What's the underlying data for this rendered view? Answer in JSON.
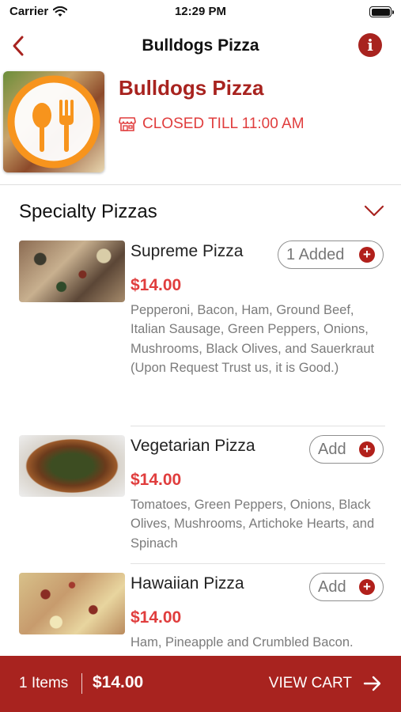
{
  "status_bar": {
    "carrier": "Carrier",
    "time": "12:29 PM"
  },
  "nav": {
    "title": "Bulldogs Pizza",
    "info_icon": "i"
  },
  "restaurant": {
    "name": "Bulldogs Pizza",
    "status": "CLOSED TILL 11:00 AM"
  },
  "section": {
    "title": "Specialty Pizzas"
  },
  "items": [
    {
      "name": "Supreme Pizza",
      "price": "$14.00",
      "description": "Pepperoni, Bacon, Ham, Ground Beef, Italian Sausage, Green Peppers, Onions, Mushrooms, Black Olives, and Sauerkraut (Upon Request Trust us, it is Good.)",
      "button_label": "1 Added"
    },
    {
      "name": "Vegetarian Pizza",
      "price": "$14.00",
      "description": "Tomatoes, Green Peppers, Onions, Black Olives, Mushrooms, Artichoke Hearts, and Spinach",
      "button_label": "Add"
    },
    {
      "name": "Hawaiian Pizza",
      "price": "$14.00",
      "description": "Ham, Pineapple and Crumbled Bacon.",
      "button_label": "Add"
    }
  ],
  "cart": {
    "count": "1 Items",
    "total": "$14.00",
    "view_label": "VIEW CART"
  },
  "colors": {
    "accent": "#a8231f",
    "price": "#e03d3d",
    "logo_orange": "#f7941d"
  },
  "icons": [
    "wifi-icon",
    "battery-icon",
    "back-chevron-icon",
    "info-icon",
    "store-icon",
    "chevron-down-icon",
    "plus-icon",
    "arrow-right-icon",
    "utensils-logo"
  ]
}
